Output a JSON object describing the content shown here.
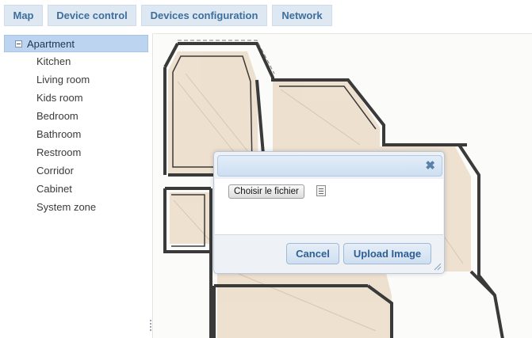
{
  "tabs": [
    {
      "label": "Map"
    },
    {
      "label": "Device control"
    },
    {
      "label": "Devices configuration"
    },
    {
      "label": "Network"
    }
  ],
  "tree": {
    "root": "Apartment",
    "items": [
      "Kitchen",
      "Living room",
      "Kids room",
      "Bedroom",
      "Bathroom",
      "Restroom",
      "Corridor",
      "Cabinet",
      "System zone"
    ]
  },
  "dialog": {
    "close": "✖",
    "file_button": "Choisir le fichier",
    "cancel": "Cancel",
    "upload": "Upload Image"
  },
  "icons": {
    "collapse": "minus-box-icon",
    "close": "close-icon",
    "file": "file-icon",
    "resize": "resize-grip-icon"
  },
  "colors": {
    "tab_bg": "#dde8f3",
    "tab_text": "#3e6e9d",
    "selected_bg": "#bcd4f0",
    "wall": "#3a3a3a",
    "floor": "#e9d3bb"
  }
}
